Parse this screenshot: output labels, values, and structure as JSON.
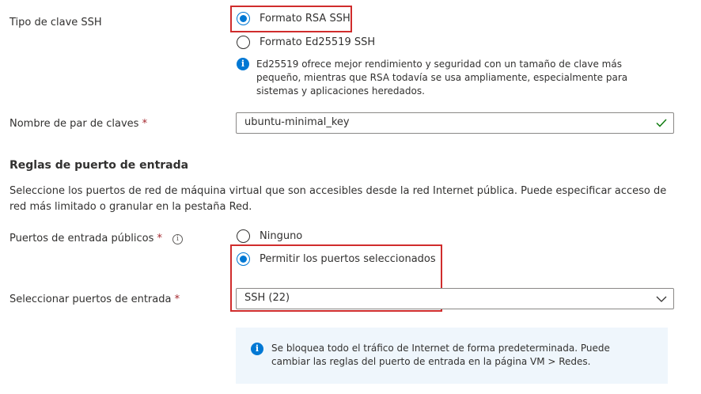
{
  "ssh_key_type": {
    "label": "Tipo de clave SSH",
    "options": [
      {
        "label": "Formato RSA SSH",
        "selected": true
      },
      {
        "label": "Formato Ed25519 SSH",
        "selected": false
      }
    ],
    "info_text": "Ed25519 ofrece mejor rendimiento y seguridad con un tamaño de clave más pequeño, mientras que RSA todavía se usa ampliamente, especialmente para sistemas y aplicaciones heredados."
  },
  "key_pair_name": {
    "label": "Nombre de par de claves",
    "required_mark": "*",
    "value": "ubuntu-minimal_key"
  },
  "inbound_rules": {
    "title": "Reglas de puerto de entrada",
    "description": "Seleccione los puertos de red de máquina virtual que son accesibles desde la red Internet pública. Puede especificar acceso de red más limitado o granular en la pestaña Red."
  },
  "public_ports": {
    "label": "Puertos de entrada públicos",
    "required_mark": "*",
    "options": [
      {
        "label": "Ninguno",
        "selected": false
      },
      {
        "label": "Permitir los puertos seleccionados",
        "selected": true
      }
    ]
  },
  "select_ports": {
    "label": "Seleccionar puertos de entrada",
    "required_mark": "*",
    "value": "SSH (22)"
  },
  "notice": {
    "text": "Se bloquea todo el tráfico de Internet de forma predeterminada. Puede cambiar las reglas del puerto de entrada en la página VM > Redes."
  },
  "colors": {
    "accent": "#0078d4",
    "highlight_box": "#d02c2c",
    "valid_check": "#107c10",
    "required": "#a4262c",
    "info_background": "#eff6fc"
  },
  "icons": {
    "info": "info-icon",
    "tooltip": "tooltip-info-icon",
    "valid": "checkmark-icon",
    "dropdown": "chevron-down-icon"
  }
}
